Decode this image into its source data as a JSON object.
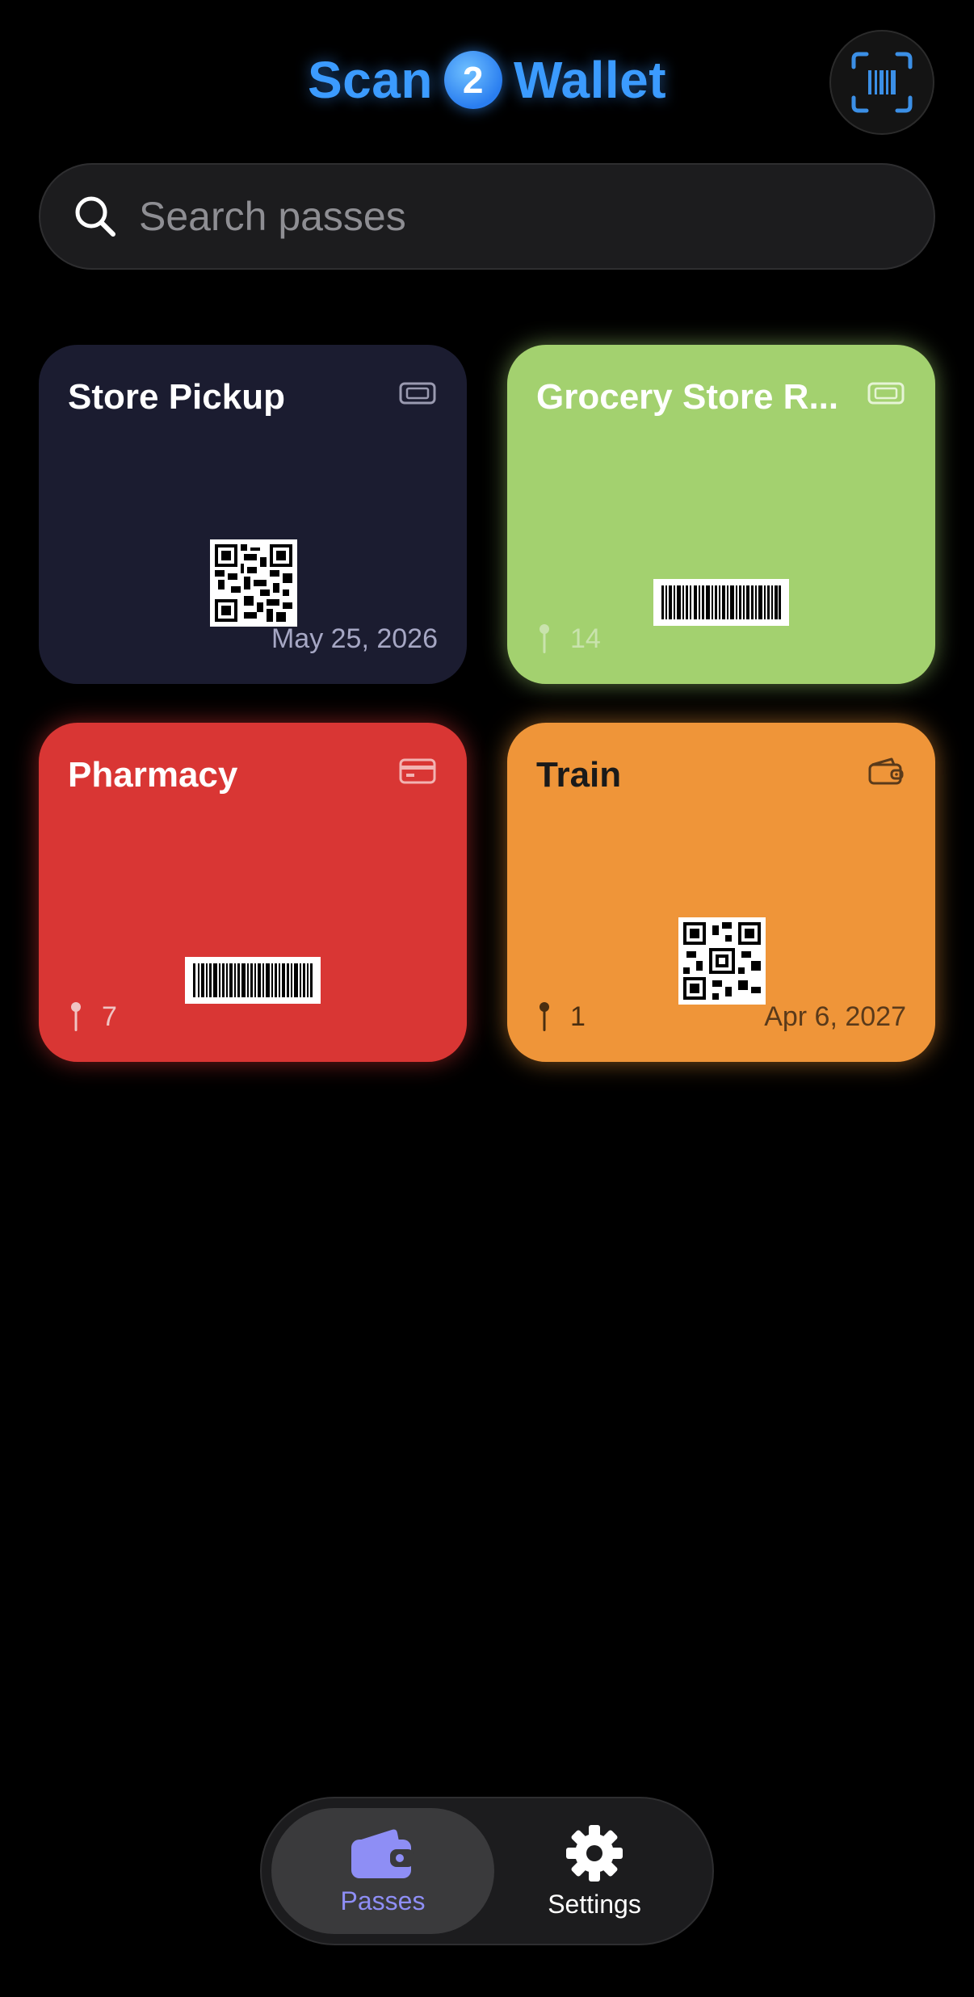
{
  "app": {
    "title_left": "Scan",
    "title_badge": "2",
    "title_right": "Wallet",
    "brand_color": "#3b9bff"
  },
  "search": {
    "placeholder": "Search passes",
    "value": ""
  },
  "passes": [
    {
      "title": "Store Pickup",
      "type_icon": "ticket-icon",
      "code_type": "qr",
      "pin_count": "",
      "date": "May 25, 2026",
      "color": "#1b1c30"
    },
    {
      "title": "Grocery Store R...",
      "type_icon": "ticket-icon",
      "code_type": "barcode",
      "pin_count": "14",
      "date": "",
      "color": "#a3d16f"
    },
    {
      "title": "Pharmacy",
      "type_icon": "credit-card-icon",
      "code_type": "barcode",
      "pin_count": "7",
      "date": "",
      "color": "#d93634"
    },
    {
      "title": "Train",
      "type_icon": "wallet-icon",
      "code_type": "qr",
      "pin_count": "1",
      "date": "Apr 6, 2027",
      "color": "#ef9539"
    }
  ],
  "tabbar": {
    "passes_label": "Passes",
    "settings_label": "Settings",
    "active_tab": "Passes",
    "active_color": "#8e8ef5"
  }
}
